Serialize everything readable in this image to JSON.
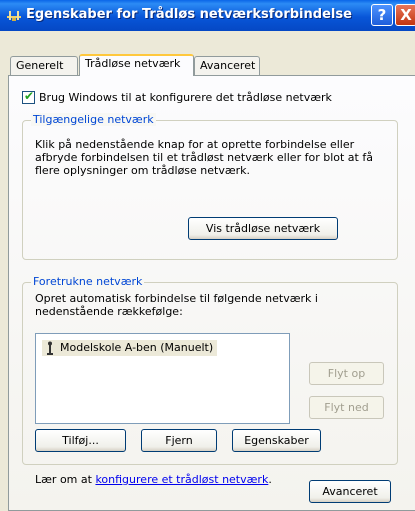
{
  "window": {
    "title": "Egenskaber for Trådløs netværksforbindelse",
    "help_glyph": "?",
    "close_glyph": "X"
  },
  "tabs": [
    {
      "label": "Generelt"
    },
    {
      "label": "Trådløse netværk",
      "active": true
    },
    {
      "label": "Avanceret"
    }
  ],
  "main": {
    "use_windows_checkbox": {
      "label": "Brug Windows til at konfigurere det trådløse netværk",
      "checked": true
    },
    "available": {
      "title": "Tilgængelige netværk",
      "text1": "Klik på nedenstående knap for at oprette forbindelse eller",
      "text2": "afbryde forbindelsen til et trådløst netværk eller for blot at få",
      "text3": "flere oplysninger om trådløse netværk.",
      "button": "Vis trådløse netværk"
    },
    "preferred": {
      "title": "Foretrukne netværk",
      "text1": "Opret automatisk forbindelse til følgende netværk i",
      "text2": "nedenstående rækkefølge:",
      "items": [
        "Modelskole A-ben (Manuelt)"
      ],
      "move_up": "Flyt op",
      "move_down": "Flyt ned",
      "add": "Tilføj...",
      "remove": "Fjern",
      "properties": "Egenskaber"
    },
    "learn_prefix": "Lær om at ",
    "learn_link": "konfigurere et trådløst netværk",
    "learn_suffix": ".",
    "advanced_button": "Avanceret"
  },
  "colors": {
    "titlebar": "#0548C4",
    "group_title": "#0046D5",
    "link": "#0000EE",
    "tab_highlight": "#FFC83C"
  }
}
